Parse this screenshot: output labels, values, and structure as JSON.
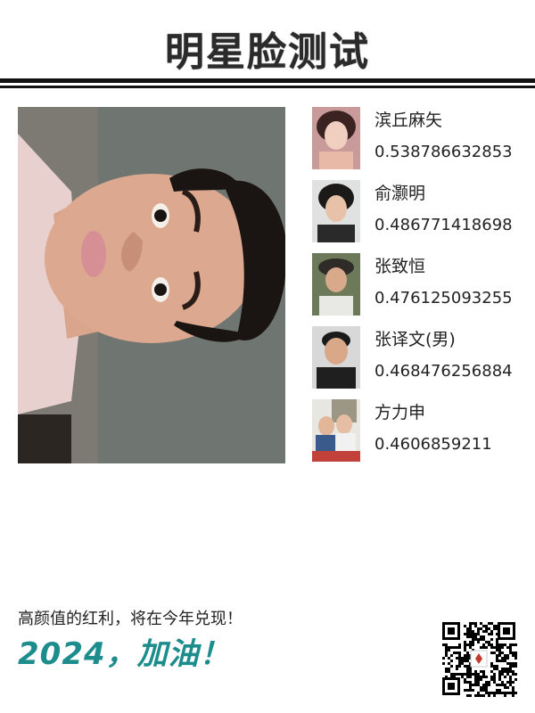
{
  "header": {
    "title": "明星脸测试"
  },
  "matches": [
    {
      "name": "滨丘麻矢",
      "score": "0.538786632853"
    },
    {
      "name": "俞灏明",
      "score": "0.486771418698"
    },
    {
      "name": "张致恒",
      "score": "0.476125093255"
    },
    {
      "name": "张译文(男)",
      "score": "0.468476256884"
    },
    {
      "name": "方力申",
      "score": "0.4606859211"
    }
  ],
  "footer": {
    "tagline": "高颜值的红利，将在今年兑现！",
    "slogan": "2024，加油！"
  },
  "colors": {
    "slogan": "#1d8c8c",
    "title": "#2b2b2b"
  },
  "icons": {
    "qr": "qr-code-icon"
  }
}
